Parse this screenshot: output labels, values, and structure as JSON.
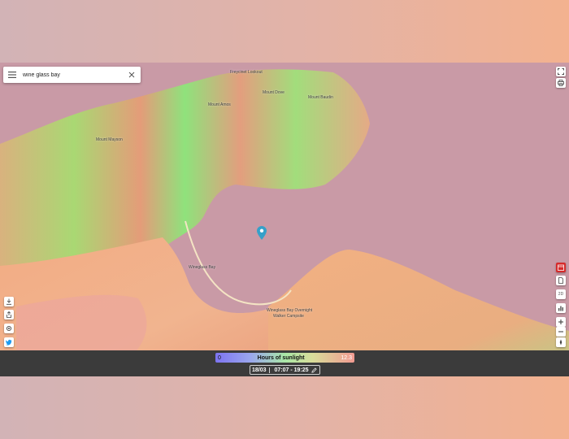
{
  "search": {
    "query": "wine glass bay"
  },
  "map": {
    "labels": [
      {
        "id": "freycinet-lookout",
        "text": "Freycinet Lookout"
      },
      {
        "id": "mount-amos",
        "text": "Mount Amos"
      },
      {
        "id": "mount-dove",
        "text": "Mount Dove"
      },
      {
        "id": "mount-baudin",
        "text": "Mount Baudin"
      },
      {
        "id": "mount-mayson",
        "text": "Mount Mayson"
      },
      {
        "id": "wineglass-bay",
        "text": "Wineglass Bay"
      },
      {
        "id": "campsite-1",
        "text": "Wineglass Bay Overnight"
      },
      {
        "id": "campsite-2",
        "text": "Walker Campsite"
      }
    ],
    "colors": {
      "sea": "#c99aa6",
      "land_warm": "#f2ac84",
      "land_green": "#8de37a",
      "land_pink": "#eca79b"
    }
  },
  "legend": {
    "title": "Hours of sunlight",
    "min": "0",
    "max": "12.3",
    "gradient": [
      "#7d74f0",
      "#9aa6ee",
      "#a9e6a6",
      "#d9dd9a",
      "#f19a91"
    ]
  },
  "time": {
    "date": "18/03",
    "range": "07:07 - 19:25"
  },
  "controls": {
    "top_right": [
      "fullscreen-icon",
      "print-icon"
    ],
    "right": [
      "calendar-icon",
      "document-icon",
      "2d-toggle",
      "chart-icon",
      "zoom-in-icon",
      "zoom-out-icon",
      "compass-icon"
    ],
    "right_labels": {
      "twod": "2D",
      "calendar": "DAY"
    },
    "left": [
      "download-icon",
      "share-icon",
      "settings-icon",
      "twitter-icon"
    ]
  }
}
